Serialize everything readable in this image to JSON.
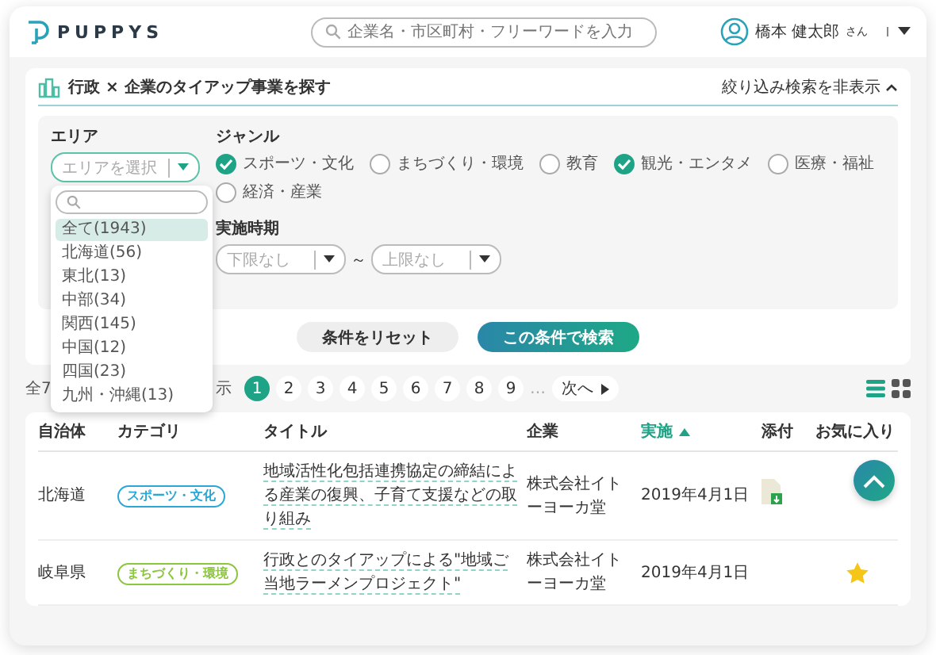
{
  "header": {
    "logo": "PUPPYS",
    "search_placeholder": "企業名・市区町村・フリーワードを入力",
    "user_name": "橋本 健太郎",
    "user_suffix": "さん"
  },
  "search_panel": {
    "title": "行政 × 企業のタイアップ事業を探す",
    "toggle": "絞り込み検索を非表示",
    "area_label": "エリア",
    "area_placeholder": "エリアを選択",
    "area_options": [
      {
        "label": "全て(1943)",
        "selected": true
      },
      {
        "label": "北海道(56)",
        "selected": false
      },
      {
        "label": "東北(13)",
        "selected": false
      },
      {
        "label": "中部(34)",
        "selected": false
      },
      {
        "label": "関西(145)",
        "selected": false
      },
      {
        "label": "中国(12)",
        "selected": false
      },
      {
        "label": "四国(23)",
        "selected": false
      },
      {
        "label": "九州・沖縄(13)",
        "selected": false
      }
    ],
    "genre_label": "ジャンル",
    "genres": [
      {
        "label": "スポーツ・文化",
        "checked": true
      },
      {
        "label": "まちづくり・環境",
        "checked": false
      },
      {
        "label": "教育",
        "checked": false
      },
      {
        "label": "観光・エンタメ",
        "checked": true
      },
      {
        "label": "医療・福祉",
        "checked": false
      },
      {
        "label": "経済・産業",
        "checked": false
      }
    ],
    "period_label": "実施時期",
    "period_from": "下限なし",
    "period_separator": "～",
    "period_to": "上限なし",
    "reset_button": "条件をリセット",
    "search_button": "この条件で検索"
  },
  "results": {
    "count_start": "全7",
    "count_end": "示",
    "pages": [
      {
        "label": "1",
        "selected": true
      },
      {
        "label": "2",
        "selected": false
      },
      {
        "label": "3",
        "selected": false
      },
      {
        "label": "4",
        "selected": false
      },
      {
        "label": "5",
        "selected": false
      },
      {
        "label": "6",
        "selected": false
      },
      {
        "label": "7",
        "selected": false
      },
      {
        "label": "8",
        "selected": false
      },
      {
        "label": "9",
        "selected": false
      }
    ],
    "ellipsis": "…",
    "next": "次へ",
    "view_modes": [
      {
        "kind": "list",
        "selected": true
      },
      {
        "kind": "grid",
        "selected": false
      }
    ]
  },
  "table": {
    "columns": [
      {
        "label": "自治体",
        "sorted": false
      },
      {
        "label": "カテゴリ",
        "sorted": false
      },
      {
        "label": "タイトル",
        "sorted": false
      },
      {
        "label": "企業",
        "sorted": false
      },
      {
        "label": "実施",
        "sorted": true
      },
      {
        "label": "添付",
        "sorted": false
      },
      {
        "label": "お気に入り",
        "sorted": false
      }
    ],
    "rows": [
      {
        "municipality": "北海道",
        "category": {
          "label": "スポーツ・文化",
          "color": "#2aa7d6"
        },
        "title": "地域活性化包括連携協定の締結による産業の復興、子育て支援などの取り組み",
        "company": "株式会社イトーヨーカ堂",
        "date": "2019年4月1日",
        "attachment": true,
        "favorite": false
      },
      {
        "municipality": "岐阜県",
        "category": {
          "label": "まちづくり・環境",
          "color": "#8cc63f"
        },
        "title": "行政とのタイアップによる\"地域ご当地ラーメンプロジェクト\"",
        "company": "株式会社イトーヨーカ堂",
        "date": "2019年4月1日",
        "attachment": false,
        "favorite": true
      }
    ]
  }
}
